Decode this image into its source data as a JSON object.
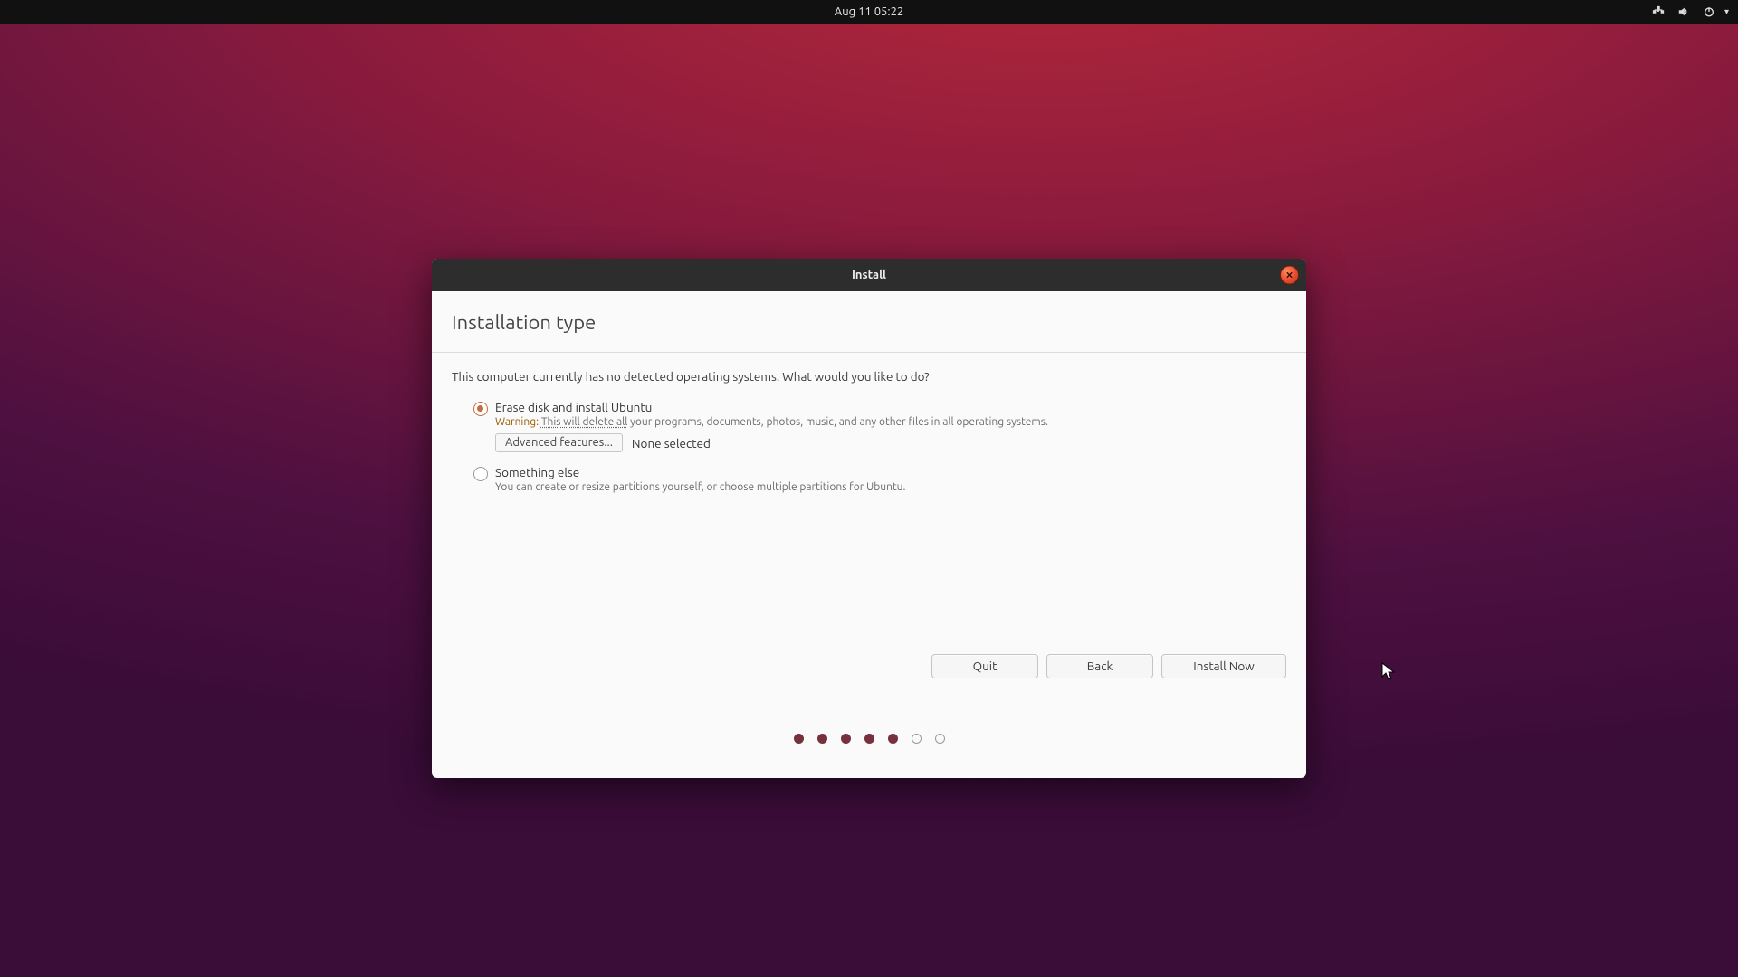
{
  "topbar": {
    "datetime": "Aug 11  05:22"
  },
  "window": {
    "title": "Install",
    "page_title": "Installation type",
    "intro": "This computer currently has no detected operating systems. What would you like to do?",
    "options": {
      "erase": {
        "label": "Erase disk and install Ubuntu",
        "warning_prefix": "Warning:",
        "warning_underlined": "This will delete all",
        "warning_rest": " your programs, documents, photos, music, and any other files in all operating systems.",
        "advanced_button": "Advanced features...",
        "advanced_status": "None selected",
        "selected": true
      },
      "something_else": {
        "label": "Something else",
        "desc": "You can create or resize partitions yourself, or choose multiple partitions for Ubuntu.",
        "selected": false
      }
    },
    "buttons": {
      "quit": "Quit",
      "back": "Back",
      "install_now": "Install Now"
    },
    "progress": {
      "total": 7,
      "completed": 5
    }
  }
}
